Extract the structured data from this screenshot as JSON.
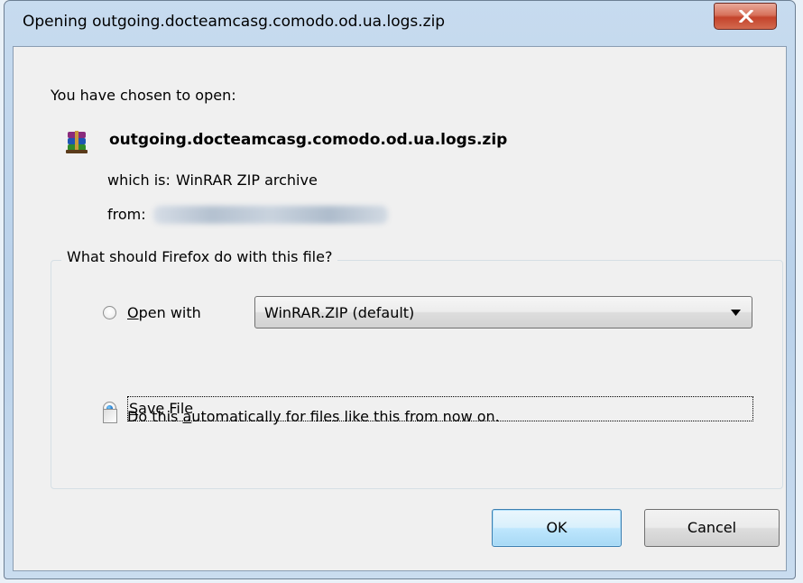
{
  "dialog": {
    "title": "Opening outgoing.docteamcasg.comodo.od.ua.logs.zip",
    "intro": "You have chosen to open:",
    "file_name": "outgoing.docteamcasg.comodo.od.ua.logs.zip",
    "which_is_label": "which is:",
    "which_is_value": "WinRAR ZIP archive",
    "from_label": "from:",
    "group_label": "What should Firefox do with this file?",
    "open_with": {
      "access_key": "O",
      "label_rest": "pen with",
      "selected": false,
      "app": "WinRAR.ZIP (default)"
    },
    "save_file": {
      "access_key": "S",
      "label_rest": "ave File",
      "selected": true
    },
    "auto": {
      "label_pre": "Do this ",
      "access_key": "a",
      "label_post": "utomatically for files like this from now on.",
      "checked": false
    },
    "ok_label": "OK",
    "cancel_label": "Cancel"
  },
  "icons": {
    "close": "close-x-icon",
    "file": "winrar-archive-icon",
    "dropdown": "dropdown-arrow-icon"
  },
  "colors": {
    "titlebar": "#b9d1ea",
    "close_button": "#c4432b",
    "default_button": "#bee6fd",
    "client_bg": "#f0f0f0"
  }
}
